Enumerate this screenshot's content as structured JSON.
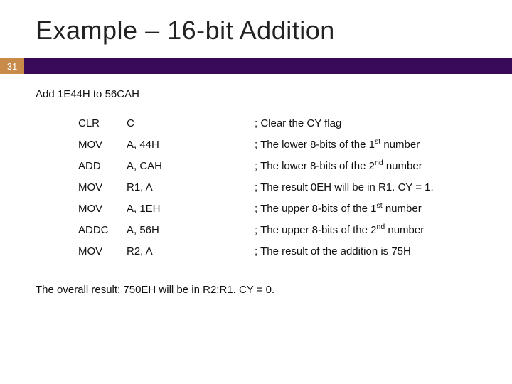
{
  "slide": {
    "number": "31",
    "title": "Example – 16-bit Addition",
    "intro": "Add 1E44H to 56CAH",
    "code": [
      {
        "op": "CLR",
        "arg": "C",
        "cm_pre": "; Clear the CY flag",
        "ord": "",
        "cm_post": ""
      },
      {
        "op": "MOV",
        "arg": "A, 44H",
        "cm_pre": "; The lower 8-bits of the 1",
        "ord": "st",
        "cm_post": " number"
      },
      {
        "op": "ADD",
        "arg": "A, CAH",
        "cm_pre": "; The lower 8-bits of the 2",
        "ord": "nd",
        "cm_post": " number"
      },
      {
        "op": "MOV",
        "arg": "R1, A",
        "cm_pre": "; The result 0EH will be in R1. CY = 1.",
        "ord": "",
        "cm_post": ""
      },
      {
        "op": "MOV",
        "arg": "A, 1EH",
        "cm_pre": "; The upper 8-bits of the 1",
        "ord": "st",
        "cm_post": " number"
      },
      {
        "op": "ADDC",
        "arg": "A, 56H",
        "cm_pre": "; The upper 8-bits of the 2",
        "ord": "nd",
        "cm_post": " number"
      },
      {
        "op": "MOV",
        "arg": "R2, A",
        "cm_pre": "; The result of the addition is 75H",
        "ord": "",
        "cm_post": ""
      }
    ],
    "footer": "The overall result: 750EH will be in R2:R1. CY = 0."
  }
}
